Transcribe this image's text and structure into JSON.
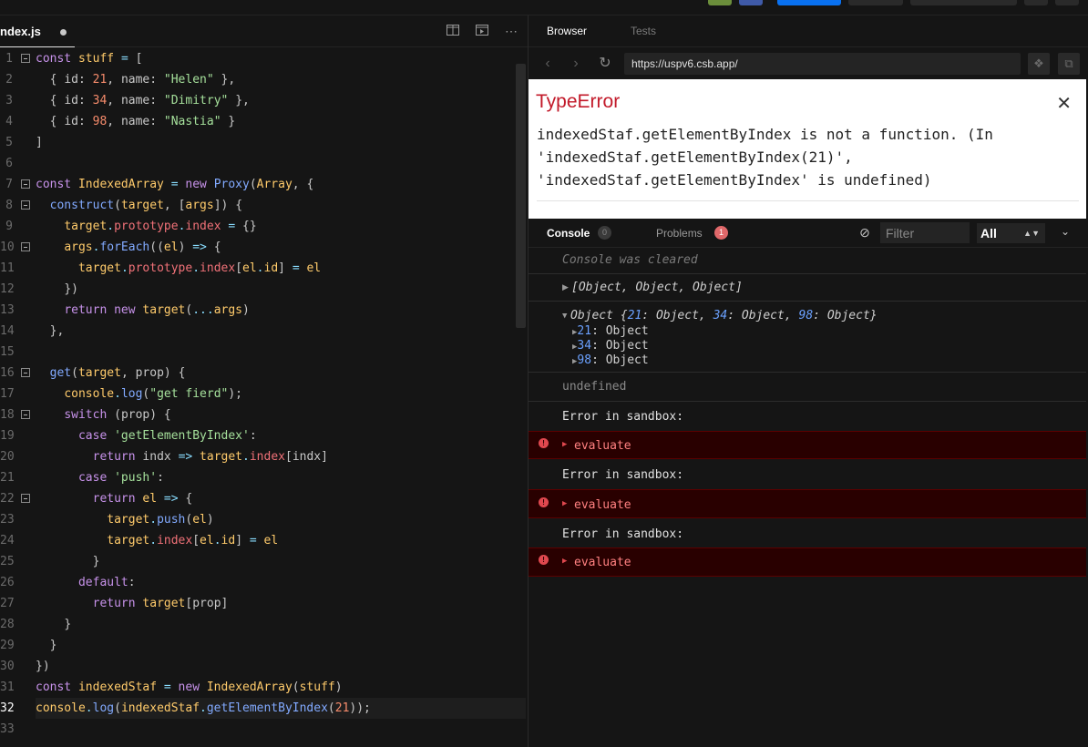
{
  "colors": {
    "accent": "#0971f1",
    "error_red": "#c21a2a",
    "problems_badge": "#e0686a"
  },
  "editor": {
    "tab": {
      "filename": "ndex.js"
    },
    "actions": {
      "split": "split-view-icon",
      "preview": "preview-icon",
      "more": "⋯"
    }
  },
  "code": {
    "lines": [
      {
        "n": "1",
        "t": "const stuff = ["
      },
      {
        "n": "2",
        "t": "  { id: 21, name: \"Helen\" },"
      },
      {
        "n": "3",
        "t": "  { id: 34, name: \"Dimitry\" },"
      },
      {
        "n": "4",
        "t": "  { id: 98, name: \"Nastia\" }"
      },
      {
        "n": "5",
        "t": "]"
      },
      {
        "n": "6",
        "t": ""
      },
      {
        "n": "7",
        "t": "const IndexedArray = new Proxy(Array, {"
      },
      {
        "n": "8",
        "t": "  construct(target, [args]) {"
      },
      {
        "n": "9",
        "t": "    target.prototype.index = {}"
      },
      {
        "n": "10",
        "t": "    args.forEach((el) => {"
      },
      {
        "n": "11",
        "t": "      target.prototype.index[el.id] = el"
      },
      {
        "n": "12",
        "t": "    })"
      },
      {
        "n": "13",
        "t": "    return new target(...args)"
      },
      {
        "n": "14",
        "t": "  },"
      },
      {
        "n": "15",
        "t": ""
      },
      {
        "n": "16",
        "t": "  get(target, prop) {"
      },
      {
        "n": "17",
        "t": "    console.log(\"get fierd\");"
      },
      {
        "n": "18",
        "t": "    switch (prop) {"
      },
      {
        "n": "19",
        "t": "      case 'getElementByIndex':"
      },
      {
        "n": "20",
        "t": "        return indx => target.index[indx]"
      },
      {
        "n": "21",
        "t": "      case 'push':"
      },
      {
        "n": "22",
        "t": "        return el => {"
      },
      {
        "n": "23",
        "t": "          target.push(el)"
      },
      {
        "n": "24",
        "t": "          target.index[el.id] = el"
      },
      {
        "n": "25",
        "t": "        }"
      },
      {
        "n": "26",
        "t": "      default:"
      },
      {
        "n": "27",
        "t": "        return target[prop]"
      },
      {
        "n": "28",
        "t": "    }"
      },
      {
        "n": "29",
        "t": "  }"
      },
      {
        "n": "30",
        "t": "})"
      },
      {
        "n": "31",
        "t": "const indexedStaf = new IndexedArray(stuff)"
      },
      {
        "n": "32",
        "t": "console.log(indexedStaf.getElementByIndex(21));"
      },
      {
        "n": "33",
        "t": ""
      }
    ]
  },
  "browser": {
    "tabs": [
      "Browser",
      "Tests"
    ],
    "url": "https://uspv6.csb.app/"
  },
  "error": {
    "title": "TypeError",
    "message": "indexedStaf.getElementByIndex is not a function. (In\n'indexedStaf.getElementByIndex(21)',\n'indexedStaf.getElementByIndex' is undefined)",
    "close": "✕"
  },
  "console": {
    "tabs": [
      {
        "label": "Console",
        "count": "0"
      },
      {
        "label": "Problems",
        "count": "1"
      }
    ],
    "filter_placeholder": "Filter",
    "level": "All",
    "cleared": "Console was cleared",
    "array_entry": "[Object, Object, Object]",
    "object_entry": {
      "prefix": "Object {",
      "pairs": [
        {
          "k": "21",
          "v": "Object"
        },
        {
          "k": "34",
          "v": "Object"
        },
        {
          "k": "98",
          "v": "Object"
        }
      ],
      "suffix": "}",
      "children": [
        {
          "k": "21",
          "v": "Object"
        },
        {
          "k": "34",
          "v": "Object"
        },
        {
          "k": "98",
          "v": "Object"
        }
      ]
    },
    "undefined_entry": "undefined",
    "error_heading": "Error in sandbox:",
    "error_entry": "evaluate"
  }
}
